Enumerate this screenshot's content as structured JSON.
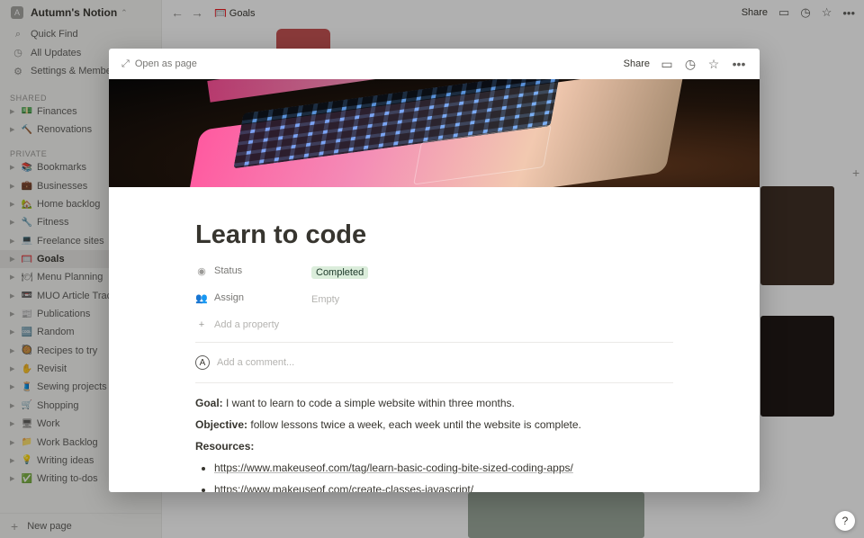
{
  "workspace": {
    "badge": "A",
    "name": "Autumn's Notion"
  },
  "sidebar": {
    "nav": [
      {
        "label": "Quick Find",
        "icon": "search-icon"
      },
      {
        "label": "All Updates",
        "icon": "clock-icon"
      },
      {
        "label": "Settings & Members",
        "icon": "gear-icon"
      }
    ],
    "shared_label": "SHARED",
    "shared": [
      {
        "label": "Finances",
        "emoji": "💵",
        "color": "#e9c46a"
      },
      {
        "label": "Renovations",
        "emoji": "🔨",
        "color": "#8d99ae"
      }
    ],
    "private_label": "PRIVATE",
    "private": [
      {
        "label": "Bookmarks",
        "emoji": "📚",
        "color": "#c0733f"
      },
      {
        "label": "Businesses",
        "emoji": "💼",
        "color": "#6b4f3a"
      },
      {
        "label": "Home backlog",
        "emoji": "🏡",
        "color": "#94a86a"
      },
      {
        "label": "Fitness",
        "emoji": "🔧",
        "color": "#a5a4a0"
      },
      {
        "label": "Freelance sites",
        "emoji": "💻",
        "color": "#3a3a3a"
      },
      {
        "label": "Goals",
        "emoji": "🥅",
        "color": "#c75050",
        "active": true
      },
      {
        "label": "Menu Planning",
        "emoji": "🍽",
        "color": "#d1cfc9"
      },
      {
        "label": "MUO Article Tracker",
        "emoji": "📼",
        "color": "#8c8b88"
      },
      {
        "label": "Publications",
        "emoji": "📰",
        "color": "#4a7bb7"
      },
      {
        "label": "Random",
        "emoji": "🆒",
        "color": "#4a7bb7"
      },
      {
        "label": "Recipes to try",
        "emoji": "🥘",
        "color": "#a5a4a0"
      },
      {
        "label": "Revisit",
        "emoji": "✋",
        "color": "#e6a23c"
      },
      {
        "label": "Sewing projects",
        "emoji": "🧵",
        "color": "#4a7bb7"
      },
      {
        "label": "Shopping",
        "emoji": "🛒",
        "color": "#8c8b88"
      },
      {
        "label": "Work",
        "emoji": "🖥",
        "color": "#3a3a3a"
      },
      {
        "label": "Work Backlog",
        "emoji": "📁",
        "color": "#6b8fb5"
      },
      {
        "label": "Writing ideas",
        "emoji": "💡",
        "color": "#f0d060"
      },
      {
        "label": "Writing to-dos",
        "emoji": "✅",
        "color": "#4caf50"
      }
    ],
    "new_page": "New page"
  },
  "topbar": {
    "breadcrumb_emoji": "🥅",
    "breadcrumb": "Goals",
    "share": "Share"
  },
  "modal": {
    "open_as_page": "Open as page",
    "share": "Share",
    "title": "Learn to code",
    "properties": [
      {
        "icon": "status-icon",
        "glyph": "◉",
        "name": "Status",
        "value": "Completed",
        "kind": "tag"
      },
      {
        "icon": "person-icon",
        "glyph": "👥",
        "name": "Assign",
        "value": "Empty",
        "kind": "empty"
      }
    ],
    "add_property": "Add a property",
    "comment_avatar": "A",
    "comment_placeholder": "Add a comment...",
    "goal_label": "Goal:",
    "goal_text": " I want to learn to code a simple website within three months.",
    "objective_label": "Objective:",
    "objective_text": " follow lessons twice a week, each week until the website is complete.",
    "resources_label": "Resources:",
    "links": [
      "https://www.makeuseof.com/tag/learn-basic-coding-bite-sized-coding-apps/",
      "https://www.makeuseof.com/create-classes-javascript/"
    ]
  },
  "help": "?"
}
